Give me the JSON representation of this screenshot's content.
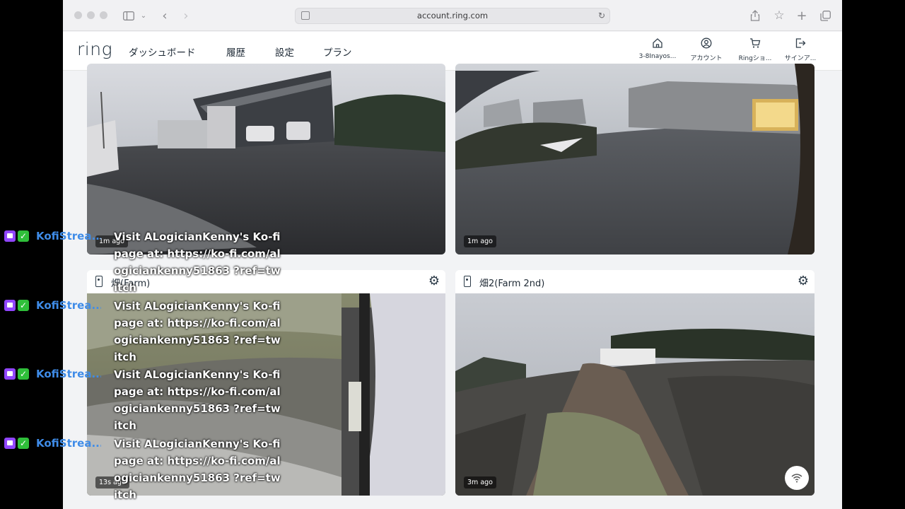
{
  "browser": {
    "url": "account.ring.com"
  },
  "header": {
    "logo": "ring",
    "nav": [
      {
        "label": "ダッシュボード",
        "active": true
      },
      {
        "label": "履歴"
      },
      {
        "label": "設定"
      },
      {
        "label": "プラン"
      }
    ],
    "actions": [
      {
        "label": "3-8Inayos...",
        "icon": "home-icon"
      },
      {
        "label": "アカウント",
        "icon": "account-icon"
      },
      {
        "label": "Ringショ...",
        "icon": "cart-icon"
      },
      {
        "label": "サインア...",
        "icon": "sign-out-icon"
      }
    ],
    "accent_color": "#1c63d8"
  },
  "cameras": [
    {
      "name": "",
      "badge": "1m ago"
    },
    {
      "name": "",
      "badge": "1m ago"
    },
    {
      "name": "畑(Farm)",
      "badge": "13s ago"
    },
    {
      "name": "畑2(Farm 2nd)",
      "badge": "3m ago"
    }
  ],
  "chat": {
    "user": "KofiStrea...",
    "messages": [
      "Visit ALogicianKenny's Ko-fi page at: https://ko-fi.com/alogiciankenny51863 ?ref=twitch",
      "Visit ALogicianKenny's Ko-fi page at: https://ko-fi.com/alogiciankenny51863 ?ref=twitch",
      "Visit ALogicianKenny's Ko-fi page at: https://ko-fi.com/alogiciankenny51863 ?ref=twitch",
      "Visit ALogicianKenny's Ko-fi page at: https://ko-fi.com/alogiciankenny51863 ?ref=twitch"
    ]
  }
}
